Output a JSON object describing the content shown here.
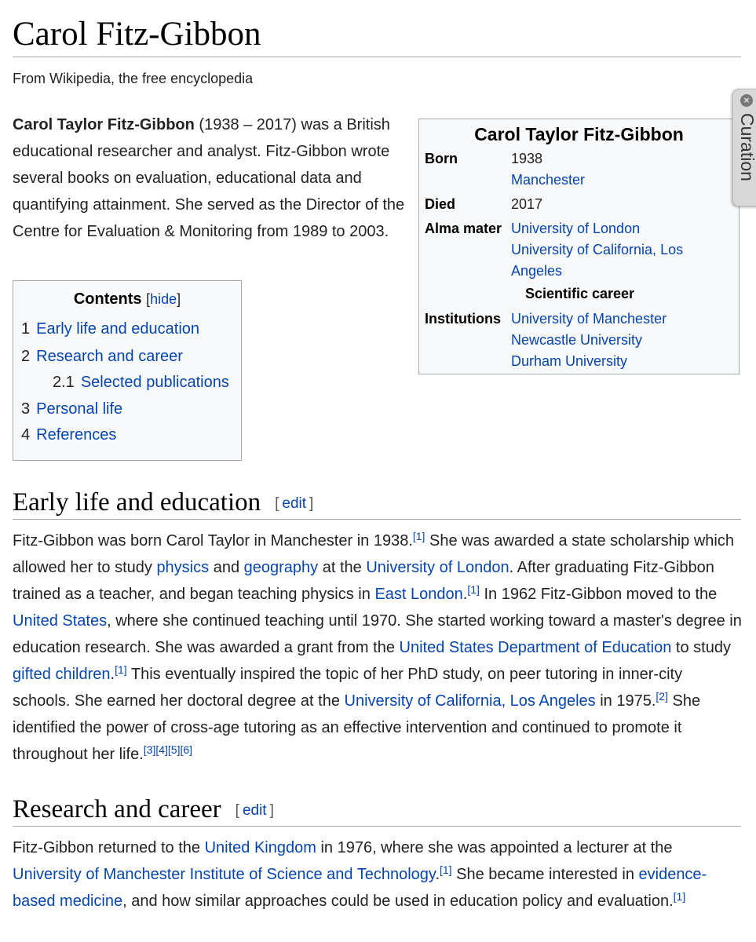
{
  "article": {
    "title": "Carol Fitz-Gibbon",
    "tagline": "From Wikipedia, the free encyclopedia"
  },
  "lead": {
    "bold_name": "Carol Taylor Fitz-Gibbon",
    "text": " (1938 – 2017) was a British educational researcher and analyst. Fitz-Gibbon wrote several books on evaluation, educational data and quantifying attainment. She served as the Director of the Centre for Evaluation & Monitoring from 1989 to 2003."
  },
  "infobox": {
    "title": "Carol Taylor Fitz-Gibbon",
    "born_label": "Born",
    "born_year": "1938",
    "born_place": "Manchester",
    "died_label": "Died",
    "died_year": "2017",
    "alma_label": "Alma mater",
    "alma_1": "University of London",
    "alma_2_line1": "University of California, Los",
    "alma_2_line2": "Angeles",
    "section": "Scientific career",
    "inst_label": "Institutions",
    "inst_1": "University of Manchester",
    "inst_2": "Newcastle University",
    "inst_3": "Durham University"
  },
  "curation": {
    "label": "Curation",
    "close": "×"
  },
  "toc": {
    "title": "Contents",
    "hide_open": "[",
    "hide": "hide",
    "hide_close": "]",
    "items": [
      {
        "num": "1",
        "label": "Early life and education"
      },
      {
        "num": "2",
        "label": "Research and career"
      },
      {
        "num": "2.1",
        "label": "Selected publications"
      },
      {
        "num": "3",
        "label": "Personal life"
      },
      {
        "num": "4",
        "label": "References"
      }
    ]
  },
  "sections": {
    "early": {
      "heading": "Early life and education",
      "edit_open": "[",
      "edit": "edit",
      "edit_close": "]",
      "p": [
        "Fitz-Gibbon was born Carol Taylor in Manchester in 1938.",
        "[1]",
        " She was awarded a state scholarship which allowed her to study ",
        "physics",
        " and ",
        "geography",
        " at the ",
        "University of London",
        ". After graduating Fitz-Gibbon trained as a teacher, and began teaching physics in ",
        "East London",
        ".",
        "[1]",
        " In 1962 Fitz-Gibbon moved to the ",
        "United States",
        ", where she continued teaching until 1970. She started working toward a master's degree in education research. She was awarded a grant from the ",
        "United States Department of Education",
        " to study ",
        "gifted children",
        ".",
        "[1]",
        " This eventually inspired the topic of her PhD study, on peer tutoring in inner-city schools. She earned her doctoral degree at the ",
        "University of California, Los Angeles",
        " in 1975.",
        "[2]",
        " She identified the power of cross-age tutoring as an effective intervention and continued to promote it throughout her life.",
        "[3][4][5][6]"
      ]
    },
    "research": {
      "heading": "Research and career",
      "edit_open": "[",
      "edit": "edit",
      "edit_close": "]",
      "p": [
        "Fitz-Gibbon returned to the ",
        "United Kingdom",
        " in 1976, where she was appointed a lecturer at the ",
        "University of Manchester Institute of Science and Technology",
        ".",
        "[1]",
        " She became interested in ",
        "evidence-based medicine",
        ", and how similar approaches could be used in education policy and evaluation.",
        "[1]"
      ]
    }
  },
  "colors": {
    "link": "#0645ad",
    "text": "#222222",
    "box_bg": "#f8f9fa",
    "border": "#a2a9b1"
  }
}
